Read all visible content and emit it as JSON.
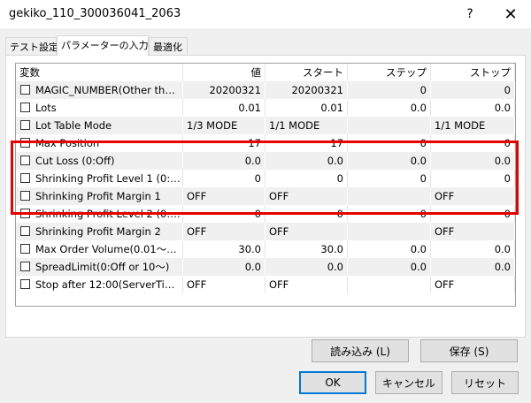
{
  "window": {
    "title": "gekiko_110_300036041_2063",
    "help_label": "?",
    "close_label": "✕"
  },
  "tabs": [
    "テスト設定",
    "パラメーターの入力",
    "最適化"
  ],
  "grid": {
    "columns": [
      "変数",
      "値",
      "スタート",
      "ステップ",
      "ストップ"
    ],
    "rows": [
      [
        "MAGIC_NUMBER(Other than...",
        "20200321",
        "20200321",
        "0",
        "0"
      ],
      [
        "Lots",
        "0.01",
        "0.01",
        "0.0",
        "0.0"
      ],
      [
        "Lot Table Mode",
        "1/3 MODE",
        "1/1 MODE",
        "",
        "1/1 MODE"
      ],
      [
        "Max Position",
        "17",
        "17",
        "0",
        "0"
      ],
      [
        "Cut Loss (0:Off)",
        "0.0",
        "0.0",
        "0.0",
        "0.0"
      ],
      [
        "Shrinking Profit Level 1 (0:Of...",
        "0",
        "0",
        "0",
        "0"
      ],
      [
        "Shrinking Profit Margin 1",
        "OFF",
        "OFF",
        "",
        "OFF"
      ],
      [
        "Shrinking Profit Level 2 (0:Off)",
        "0",
        "0",
        "0",
        "0"
      ],
      [
        "Shrinking Profit Margin 2",
        "OFF",
        "OFF",
        "",
        "OFF"
      ],
      [
        "Max Order Volume(0.01～30)",
        "30.0",
        "30.0",
        "0.0",
        "0.0"
      ],
      [
        "SpreadLimit(0:Off or 10～)",
        "0.0",
        "0.0",
        "0.0",
        "0.0"
      ],
      [
        "Stop after 12:00(ServerTime)...",
        "OFF",
        "OFF",
        "",
        "OFF"
      ]
    ]
  },
  "buttons": {
    "load": "読み込み (L)",
    "save": "保存 (S)",
    "ok": "OK",
    "cancel": "キャンセル",
    "reset": "リセット"
  },
  "colors": {
    "highlight": "#e60000",
    "default_button_border": "#0078d7"
  }
}
